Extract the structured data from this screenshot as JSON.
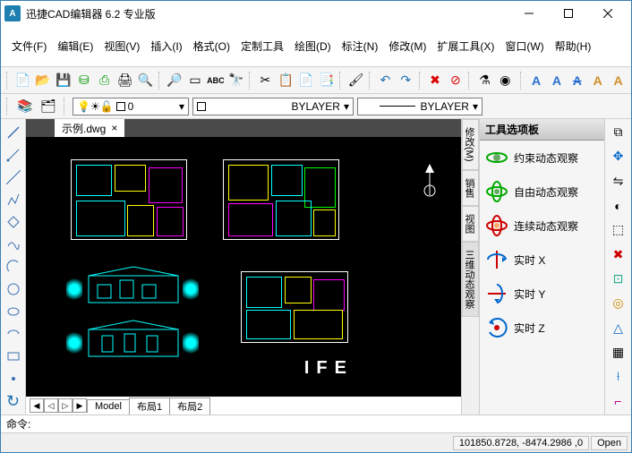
{
  "title": "迅捷CAD编辑器 6.2 专业版",
  "menus": [
    "文件(F)",
    "编辑(E)",
    "视图(V)",
    "插入(I)",
    "格式(O)",
    "定制工具",
    "绘图(D)",
    "标注(N)",
    "修改(M)",
    "扩展工具(X)",
    "窗口(W)",
    "帮助(H)"
  ],
  "doc_tab": "示例.dwg",
  "layer_combo": "0",
  "color_combo": "BYLAYER",
  "lineweight_combo": "BYLAYER",
  "model_tabs": {
    "model": "Model",
    "layout1": "布局1",
    "layout2": "布局2"
  },
  "palette": {
    "header": "工具选项板",
    "items": [
      {
        "label": "约束动态观察"
      },
      {
        "label": "自由动态观察"
      },
      {
        "label": "连续动态观察"
      },
      {
        "label": "实时 X"
      },
      {
        "label": "实时 Y"
      },
      {
        "label": "实时 Z"
      }
    ]
  },
  "vtabs": [
    "修改(M)",
    "销售",
    "视图",
    "三维动态观察"
  ],
  "cmd_prompt": "命令:",
  "status_coords": "101850.8728, -8474.2986 ,0",
  "status_mode": "Open",
  "drawing_text": "IFE"
}
